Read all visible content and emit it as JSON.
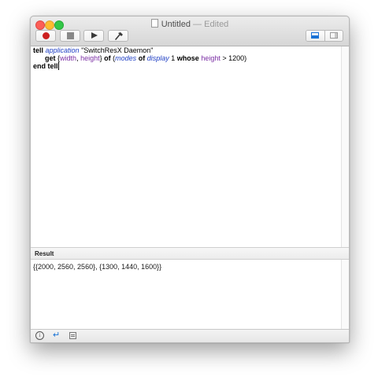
{
  "window": {
    "title": "Untitled",
    "separator": "—",
    "status": "Edited"
  },
  "toolbar": {
    "buttons": [
      {
        "name": "record",
        "icon": "record-icon"
      },
      {
        "name": "stop",
        "icon": "stop-icon"
      },
      {
        "name": "run",
        "icon": "play-icon"
      },
      {
        "name": "compile",
        "icon": "hammer-icon"
      }
    ],
    "view_toggle": [
      {
        "name": "show-result-pane",
        "icon": "bottom-panel-icon",
        "active": true
      },
      {
        "name": "show-sidebar",
        "icon": "side-panel-icon",
        "active": false
      }
    ]
  },
  "script": {
    "line1": {
      "kw": "tell",
      "cls": "application",
      "str": "\"SwitchResX Daemon\""
    },
    "line2": {
      "kw_get": "get",
      "open_brace": "{",
      "prop_width": "width",
      "comma": ",",
      "prop_height": "height",
      "close_brace": "}",
      "kw_of": "of",
      "open_paren": "(",
      "cls_modes": "modes",
      "kw_of2": "of",
      "cls_display": "display",
      "num": "1",
      "kw_whose": "whose",
      "prop_height2": "height",
      "op": ">",
      "value": "1200)"
    },
    "line3": {
      "kw": "end tell"
    }
  },
  "result_pane": {
    "label": "Result",
    "value": "{{2000, 2560, 2560}, {1300, 1440, 1600}}"
  },
  "footer": {
    "buttons": [
      {
        "name": "description",
        "icon": "info-icon"
      },
      {
        "name": "events",
        "icon": "reply-arrow-icon"
      },
      {
        "name": "log",
        "icon": "list-icon"
      }
    ]
  },
  "colors": {
    "keyword": "#000000",
    "class": "#1f3fc4",
    "property": "#7b2fa4",
    "record": "#cc1f1f",
    "accent": "#1a73d6"
  }
}
